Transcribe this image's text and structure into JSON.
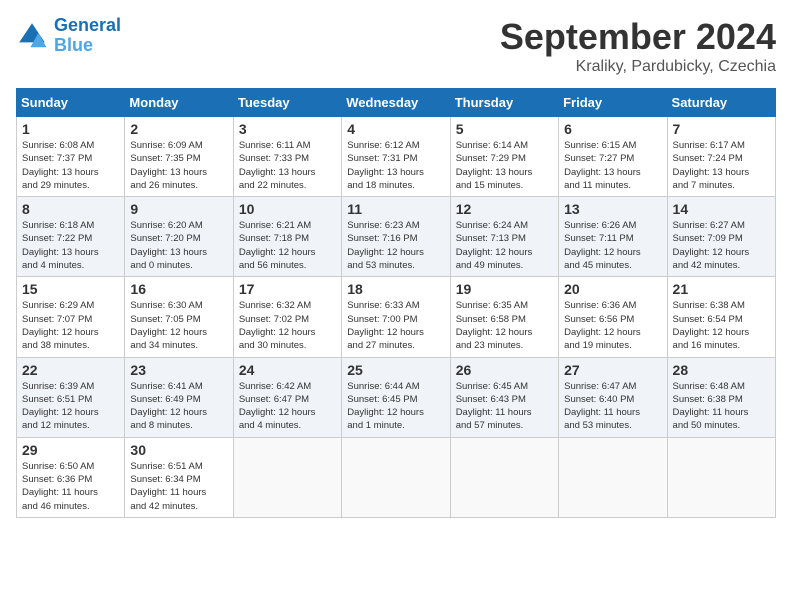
{
  "header": {
    "logo_line1": "General",
    "logo_line2": "Blue",
    "month": "September 2024",
    "location": "Kraliky, Pardubicky, Czechia"
  },
  "days_of_week": [
    "Sunday",
    "Monday",
    "Tuesday",
    "Wednesday",
    "Thursday",
    "Friday",
    "Saturday"
  ],
  "weeks": [
    [
      {
        "day": "1",
        "detail": "Sunrise: 6:08 AM\nSunset: 7:37 PM\nDaylight: 13 hours\nand 29 minutes."
      },
      {
        "day": "2",
        "detail": "Sunrise: 6:09 AM\nSunset: 7:35 PM\nDaylight: 13 hours\nand 26 minutes."
      },
      {
        "day": "3",
        "detail": "Sunrise: 6:11 AM\nSunset: 7:33 PM\nDaylight: 13 hours\nand 22 minutes."
      },
      {
        "day": "4",
        "detail": "Sunrise: 6:12 AM\nSunset: 7:31 PM\nDaylight: 13 hours\nand 18 minutes."
      },
      {
        "day": "5",
        "detail": "Sunrise: 6:14 AM\nSunset: 7:29 PM\nDaylight: 13 hours\nand 15 minutes."
      },
      {
        "day": "6",
        "detail": "Sunrise: 6:15 AM\nSunset: 7:27 PM\nDaylight: 13 hours\nand 11 minutes."
      },
      {
        "day": "7",
        "detail": "Sunrise: 6:17 AM\nSunset: 7:24 PM\nDaylight: 13 hours\nand 7 minutes."
      }
    ],
    [
      {
        "day": "8",
        "detail": "Sunrise: 6:18 AM\nSunset: 7:22 PM\nDaylight: 13 hours\nand 4 minutes."
      },
      {
        "day": "9",
        "detail": "Sunrise: 6:20 AM\nSunset: 7:20 PM\nDaylight: 13 hours\nand 0 minutes."
      },
      {
        "day": "10",
        "detail": "Sunrise: 6:21 AM\nSunset: 7:18 PM\nDaylight: 12 hours\nand 56 minutes."
      },
      {
        "day": "11",
        "detail": "Sunrise: 6:23 AM\nSunset: 7:16 PM\nDaylight: 12 hours\nand 53 minutes."
      },
      {
        "day": "12",
        "detail": "Sunrise: 6:24 AM\nSunset: 7:13 PM\nDaylight: 12 hours\nand 49 minutes."
      },
      {
        "day": "13",
        "detail": "Sunrise: 6:26 AM\nSunset: 7:11 PM\nDaylight: 12 hours\nand 45 minutes."
      },
      {
        "day": "14",
        "detail": "Sunrise: 6:27 AM\nSunset: 7:09 PM\nDaylight: 12 hours\nand 42 minutes."
      }
    ],
    [
      {
        "day": "15",
        "detail": "Sunrise: 6:29 AM\nSunset: 7:07 PM\nDaylight: 12 hours\nand 38 minutes."
      },
      {
        "day": "16",
        "detail": "Sunrise: 6:30 AM\nSunset: 7:05 PM\nDaylight: 12 hours\nand 34 minutes."
      },
      {
        "day": "17",
        "detail": "Sunrise: 6:32 AM\nSunset: 7:02 PM\nDaylight: 12 hours\nand 30 minutes."
      },
      {
        "day": "18",
        "detail": "Sunrise: 6:33 AM\nSunset: 7:00 PM\nDaylight: 12 hours\nand 27 minutes."
      },
      {
        "day": "19",
        "detail": "Sunrise: 6:35 AM\nSunset: 6:58 PM\nDaylight: 12 hours\nand 23 minutes."
      },
      {
        "day": "20",
        "detail": "Sunrise: 6:36 AM\nSunset: 6:56 PM\nDaylight: 12 hours\nand 19 minutes."
      },
      {
        "day": "21",
        "detail": "Sunrise: 6:38 AM\nSunset: 6:54 PM\nDaylight: 12 hours\nand 16 minutes."
      }
    ],
    [
      {
        "day": "22",
        "detail": "Sunrise: 6:39 AM\nSunset: 6:51 PM\nDaylight: 12 hours\nand 12 minutes."
      },
      {
        "day": "23",
        "detail": "Sunrise: 6:41 AM\nSunset: 6:49 PM\nDaylight: 12 hours\nand 8 minutes."
      },
      {
        "day": "24",
        "detail": "Sunrise: 6:42 AM\nSunset: 6:47 PM\nDaylight: 12 hours\nand 4 minutes."
      },
      {
        "day": "25",
        "detail": "Sunrise: 6:44 AM\nSunset: 6:45 PM\nDaylight: 12 hours\nand 1 minute."
      },
      {
        "day": "26",
        "detail": "Sunrise: 6:45 AM\nSunset: 6:43 PM\nDaylight: 11 hours\nand 57 minutes."
      },
      {
        "day": "27",
        "detail": "Sunrise: 6:47 AM\nSunset: 6:40 PM\nDaylight: 11 hours\nand 53 minutes."
      },
      {
        "day": "28",
        "detail": "Sunrise: 6:48 AM\nSunset: 6:38 PM\nDaylight: 11 hours\nand 50 minutes."
      }
    ],
    [
      {
        "day": "29",
        "detail": "Sunrise: 6:50 AM\nSunset: 6:36 PM\nDaylight: 11 hours\nand 46 minutes."
      },
      {
        "day": "30",
        "detail": "Sunrise: 6:51 AM\nSunset: 6:34 PM\nDaylight: 11 hours\nand 42 minutes."
      },
      {
        "day": "",
        "detail": ""
      },
      {
        "day": "",
        "detail": ""
      },
      {
        "day": "",
        "detail": ""
      },
      {
        "day": "",
        "detail": ""
      },
      {
        "day": "",
        "detail": ""
      }
    ]
  ]
}
